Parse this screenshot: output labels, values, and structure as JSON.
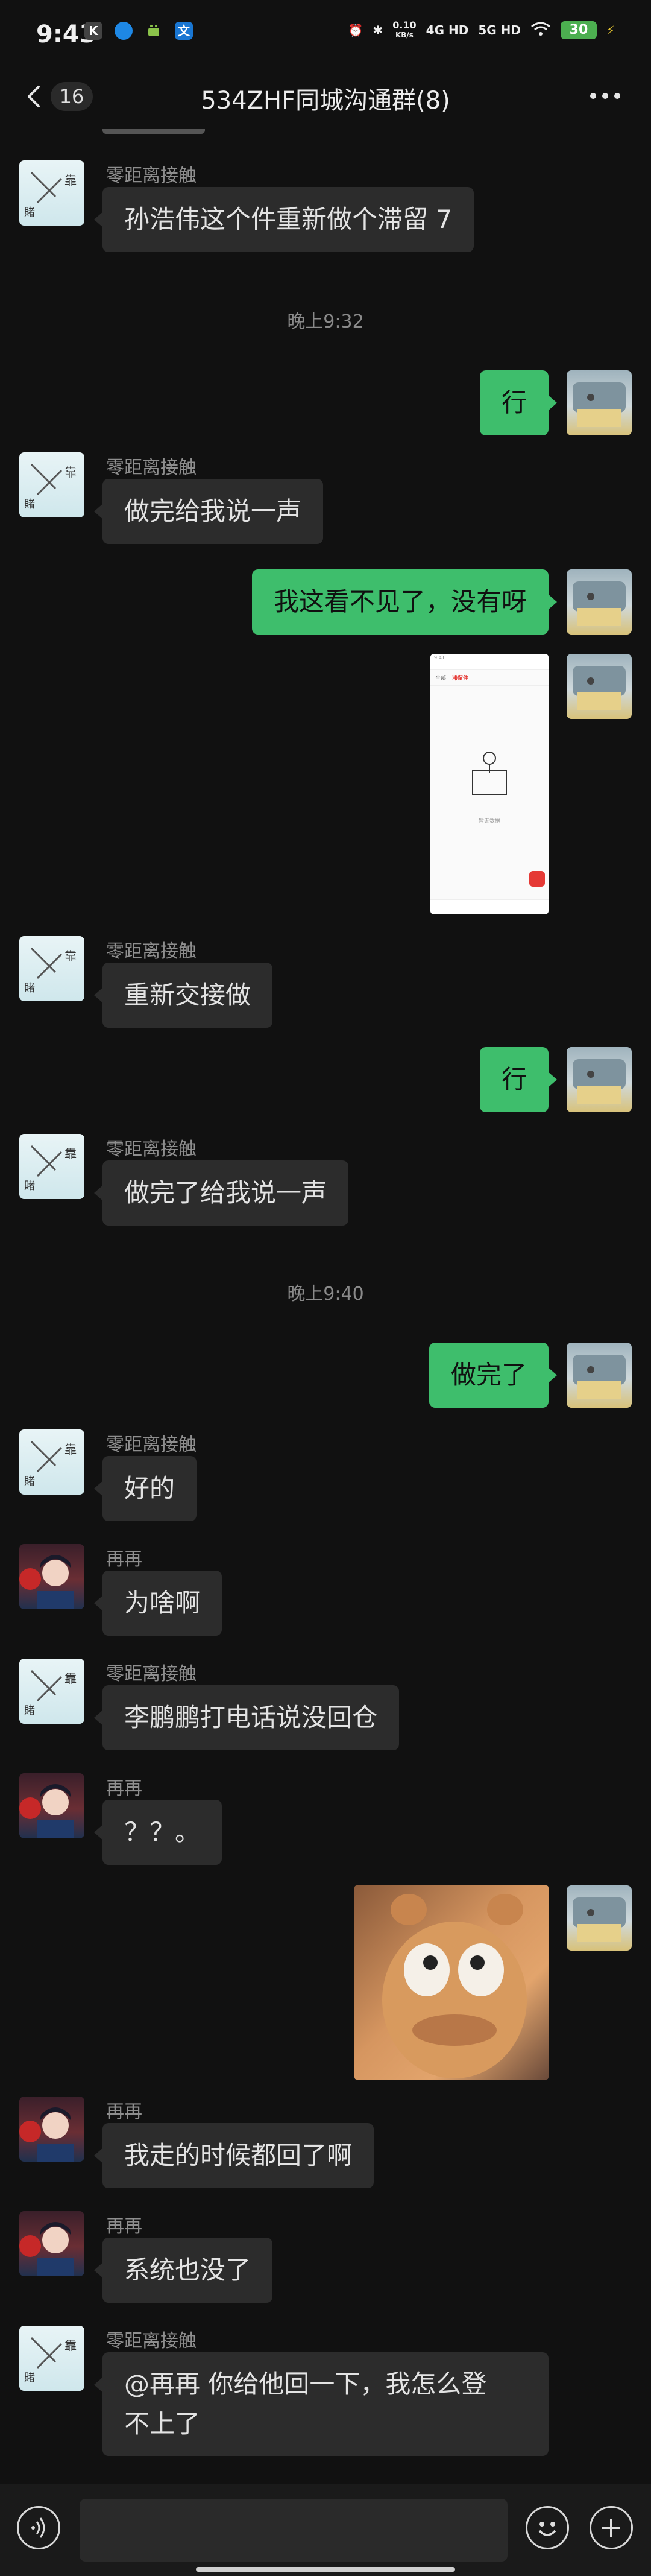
{
  "status_bar": {
    "time": "9:43",
    "left_icons": [
      "K",
      "",
      "",
      "文"
    ],
    "speed_value": "0.10",
    "speed_unit": "KB/s",
    "net1": "4G HD",
    "net2": "5G HD",
    "battery": "30"
  },
  "header": {
    "back_count": "16",
    "title": "534ZHF同城沟通群(8)"
  },
  "messages": [
    {
      "side": "left",
      "sender": "零距离接触",
      "avatar": "girl",
      "text": "孙浩伟这个件重新做个滞留 7"
    },
    {
      "type": "time",
      "text": "晚上9:32"
    },
    {
      "side": "right",
      "avatar": "me",
      "text": "行"
    },
    {
      "side": "left",
      "sender": "零距离接触",
      "avatar": "girl",
      "text": "做完给我说一声"
    },
    {
      "side": "right",
      "avatar": "me",
      "text": "我这看不见了，没有呀"
    },
    {
      "side": "right",
      "avatar": "me",
      "type": "screenshot",
      "screenshot": {
        "tab1": "全部",
        "tab2": "滞留件",
        "empty_text": "暂无数据"
      }
    },
    {
      "side": "left",
      "sender": "零距离接触",
      "avatar": "girl",
      "text": "重新交接做"
    },
    {
      "side": "right",
      "avatar": "me",
      "text": "行"
    },
    {
      "side": "left",
      "sender": "零距离接触",
      "avatar": "girl",
      "text": "做完了给我说一声"
    },
    {
      "type": "time",
      "text": "晚上9:40"
    },
    {
      "side": "right",
      "avatar": "me",
      "text": "做完了"
    },
    {
      "side": "left",
      "sender": "零距离接触",
      "avatar": "girl",
      "text": "好的"
    },
    {
      "side": "left",
      "sender": "再再",
      "avatar": "boy",
      "text": "为啥啊"
    },
    {
      "side": "left",
      "sender": "零距离接触",
      "avatar": "girl",
      "text": "李鹏鹏打电话说没回仓"
    },
    {
      "side": "left",
      "sender": "再再",
      "avatar": "boy",
      "text": "？？。"
    },
    {
      "side": "right",
      "avatar": "me",
      "type": "sticker"
    },
    {
      "side": "left",
      "sender": "再再",
      "avatar": "boy",
      "text": "我走的时候都回了啊"
    },
    {
      "side": "left",
      "sender": "再再",
      "avatar": "boy",
      "text": "系统也没了"
    },
    {
      "side": "left",
      "sender": "零距离接触",
      "avatar": "girl",
      "text_line1": "@再再  你给他回一下，我怎么登",
      "text_line2": "不上了"
    }
  ],
  "colors": {
    "background": "#111111",
    "bubble_left": "#2c2c2c",
    "bubble_right": "#3ebe6c",
    "meta_text": "#8a8a8a"
  },
  "icons": [
    "back-arrow-icon",
    "more-dots-icon",
    "voice-icon",
    "emoji-icon",
    "plus-icon"
  ]
}
